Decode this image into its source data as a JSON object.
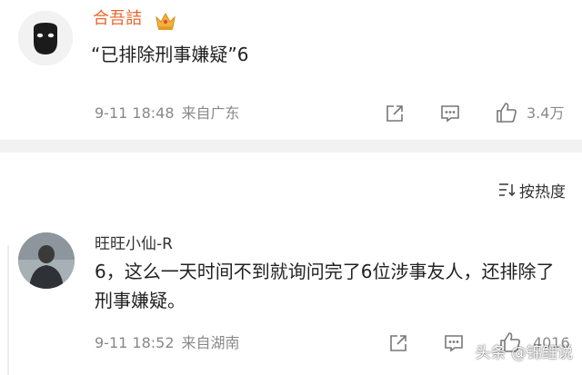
{
  "comments": [
    {
      "username": "合吾詰",
      "text": "“已排除刑事嫌疑”6",
      "date": "9-11 18:48",
      "location": "来自广东",
      "like_count": "3.4万",
      "avatar": "mask-avatar",
      "badge": "crown-icon"
    },
    {
      "username": "旺旺小仙-R",
      "text": "6，这么一天时间不到就询问完了6位涉事友人，还排除了刑事嫌疑。",
      "date": "9-11 18:52",
      "location": "来自湖南",
      "like_count": "4016",
      "avatar": "photo-avatar"
    }
  ],
  "sort": {
    "label": "按热度",
    "icon": "sort-icon"
  },
  "watermark": {
    "text": "头条 @锦鲤说"
  },
  "colors": {
    "accent_username": "#e8652b",
    "meta_gray": "#888888",
    "divider": "#f2f2f2"
  }
}
